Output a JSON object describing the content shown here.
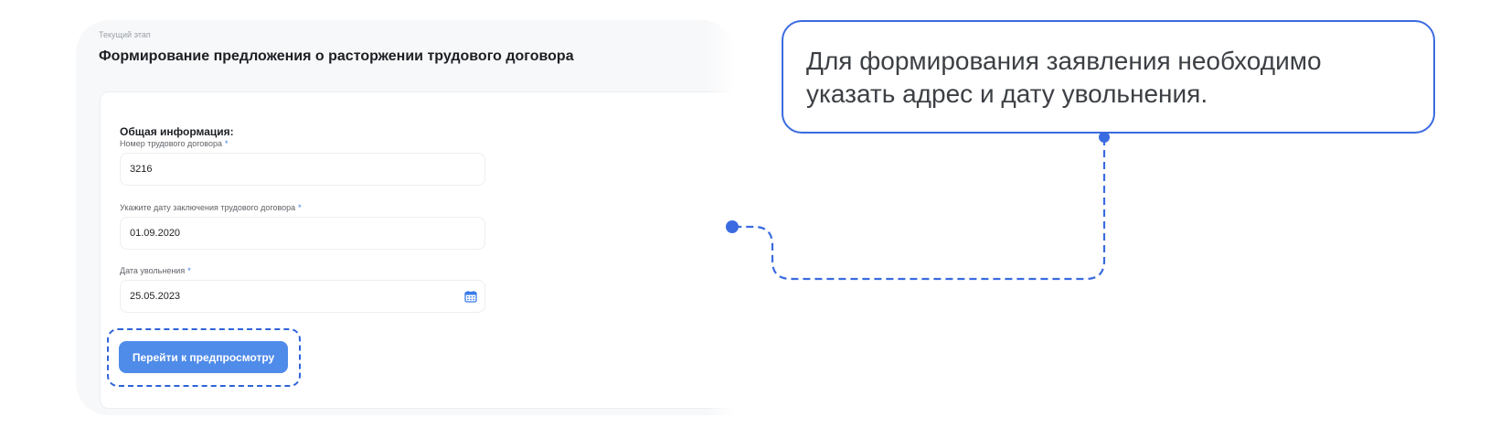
{
  "stage": {
    "caption": "Текущий этап",
    "title": "Формирование предложения о расторжении трудового договора"
  },
  "form": {
    "section_title": "Общая информация:",
    "required_mark": "*",
    "contract_number": {
      "label": "Номер трудового договора",
      "value": "3216"
    },
    "contract_date": {
      "label": "Укажите дату заключения трудового договора",
      "value": "01.09.2020"
    },
    "dismissal_date": {
      "label": "Дата увольнения",
      "value": "25.05.2023",
      "icon": "calendar-icon"
    },
    "preview_button": "Перейти к предпросмотру"
  },
  "callout": {
    "text": "Для формирования заявления необходимо указать адрес и дату увольнения."
  },
  "colors": {
    "accent": "#3a6be0",
    "button": "#4f8be9",
    "card_bg": "#f7f8fa",
    "required": "#3a7be8"
  }
}
